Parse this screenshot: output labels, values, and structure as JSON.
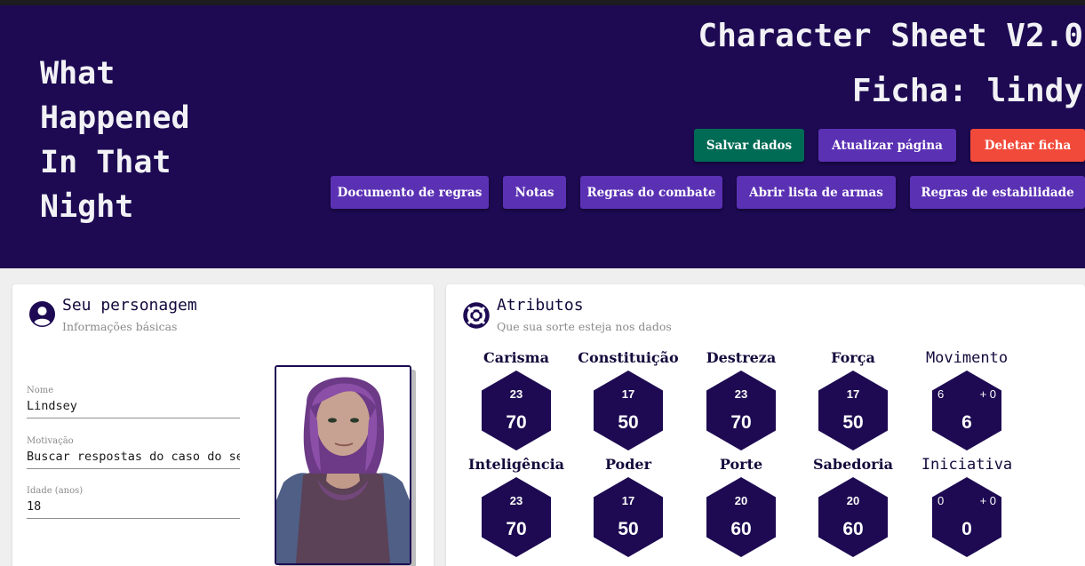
{
  "header": {
    "game_title_lines": [
      "What",
      "Happened",
      "In That",
      "Night"
    ],
    "sheet_title": "Character Sheet V2.0",
    "sheet_name": "Ficha: lindy",
    "actions": {
      "save": "Salvar dados",
      "refresh": "Atualizar página",
      "delete": "Deletar ficha"
    },
    "links": {
      "rules_doc": "Documento de regras",
      "notes": "Notas",
      "combat_rules": "Regras do combate",
      "weapons_list": "Abrir lista de armas",
      "stability_rules": "Regras de estabilidade"
    }
  },
  "colors": {
    "header_bg": "#1d0a52",
    "accent_purple": "#5b31b4",
    "save_green": "#006b55",
    "delete_red": "#f24a3a",
    "hex_fill": "#1d0a52"
  },
  "character_card": {
    "icon": "person-circle-icon",
    "title": "Seu personagem",
    "subtitle": "Informações básicas",
    "fields": [
      {
        "label": "Nome",
        "value": "Lindsey"
      },
      {
        "label": "Motivação",
        "value": "Buscar respostas do caso do seu a"
      },
      {
        "label": "Idade (anos)",
        "value": "18"
      }
    ]
  },
  "attributes_card": {
    "icon": "life-ring-icon",
    "title": "Atributos",
    "subtitle": "Que sua sorte esteja nos dados",
    "attributes": [
      {
        "name": "Carisma",
        "top": "23",
        "value": "70"
      },
      {
        "name": "Constituição",
        "top": "17",
        "value": "50"
      },
      {
        "name": "Destreza",
        "top": "23",
        "value": "70"
      },
      {
        "name": "Força",
        "top": "17",
        "value": "50"
      },
      {
        "name": "Inteligência",
        "top": "23",
        "value": "70"
      },
      {
        "name": "Poder",
        "top": "17",
        "value": "50"
      },
      {
        "name": "Porte",
        "top": "20",
        "value": "60"
      },
      {
        "name": "Sabedoria",
        "top": "20",
        "value": "60"
      }
    ],
    "derived": [
      {
        "name": "Movimento",
        "left": "6",
        "right": "+ 0",
        "value": "6"
      },
      {
        "name": "Iniciativa",
        "left": "0",
        "right": "+ 0",
        "value": "0"
      }
    ]
  }
}
